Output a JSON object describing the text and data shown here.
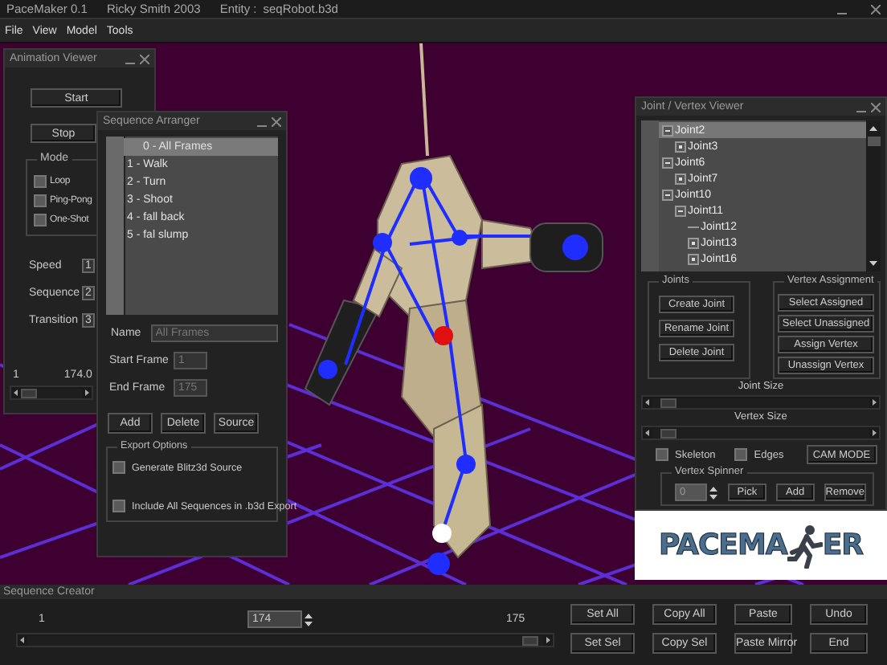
{
  "app": {
    "title": "PaceMaker 0.1",
    "author": "Ricky Smith 2003",
    "entity_label": "Entity  :",
    "entity": "seqRobot.b3d"
  },
  "menu": [
    "File",
    "View",
    "Model",
    "Tools"
  ],
  "animation_viewer": {
    "title": "Animation Viewer",
    "buttons": [
      "Start",
      "Stop"
    ],
    "mode_label": "Mode",
    "modes": [
      {
        "label": "Loop",
        "checked": false
      },
      {
        "label": "Ping-Pong",
        "checked": false
      },
      {
        "label": "One-Shot",
        "checked": false
      }
    ],
    "fields": [
      {
        "label": "Speed",
        "value": "1"
      },
      {
        "label": "Sequence",
        "value": "2"
      },
      {
        "label": "Transition",
        "value": "3"
      }
    ],
    "frame_start": "1",
    "frame_current": "174.0",
    "slider": {
      "level": 0
    }
  },
  "sequence_arranger": {
    "title": "Sequence Arranger",
    "sequences": [
      {
        "label": "0 - All Frames",
        "selected": true
      },
      {
        "label": "1 - Walk",
        "selected": false
      },
      {
        "label": "2 - Turn",
        "selected": false
      },
      {
        "label": "3 - Shoot",
        "selected": false
      },
      {
        "label": "4 - fall back",
        "selected": false
      },
      {
        "label": "5 - fal slump",
        "selected": false
      }
    ],
    "name_label": "Name",
    "name_value": "All Frames",
    "start_label": "Start Frame",
    "start_value": "1",
    "end_label": "End Frame",
    "end_value": "175",
    "buttons": [
      "Add",
      "Delete",
      "Source"
    ],
    "export_title": "Export Options",
    "export_options": [
      {
        "label": "Generate Blitz3d Source",
        "checked": false
      },
      {
        "label": "Include All Sequences in .b3d Export",
        "checked": false
      }
    ]
  },
  "joint_viewer": {
    "title": "Joint / Vertex Viewer",
    "tree": [
      {
        "label": "Joint2",
        "kind": "node",
        "expanded": true,
        "selected": true,
        "children": [
          {
            "label": "Joint3",
            "kind": "node",
            "expanded": false,
            "selected": false
          }
        ]
      },
      {
        "label": "Joint6",
        "kind": "node",
        "expanded": true,
        "selected": false,
        "children": [
          {
            "label": "Joint7",
            "kind": "node",
            "expanded": false,
            "selected": false
          }
        ]
      },
      {
        "label": "Joint10",
        "kind": "node",
        "expanded": true,
        "selected": false,
        "children": [
          {
            "label": "Joint11",
            "kind": "node",
            "expanded": true,
            "selected": false,
            "children": [
              {
                "label": "Joint12",
                "kind": "leaf",
                "expanded": false,
                "selected": false
              },
              {
                "label": "Joint13",
                "kind": "node",
                "expanded": false,
                "selected": false
              },
              {
                "label": "Joint16",
                "kind": "node",
                "expanded": false,
                "selected": false
              }
            ]
          }
        ]
      }
    ],
    "joints_title": "Joints",
    "joint_buttons": [
      "Create Joint",
      "Rename Joint",
      "Delete Joint"
    ],
    "vertex_title": "Vertex Assignment",
    "vertex_buttons": [
      "Select  Assigned",
      "Select  Unassigned",
      "Assign  Vertex",
      "Unassign Vertex"
    ],
    "sliders": [
      {
        "label": "Joint  Size",
        "level": 0.04
      },
      {
        "label": "Vertex Size",
        "level": 0.04
      }
    ],
    "toggles": [
      {
        "label": "Skeleton",
        "checked": false
      },
      {
        "label": "Edges",
        "checked": false
      }
    ],
    "cam_button": "CAM MODE",
    "spinner_title": "Vertex  Spinner",
    "spinner_value": "0",
    "spinner_buttons": [
      "Pick",
      "Add",
      "Remove"
    ]
  },
  "logo": {
    "left": "PACEMA",
    "right": "ER"
  },
  "sequence_creator": {
    "title": "Sequence Creator",
    "start": "1",
    "current": "174",
    "end": "175",
    "slider": {
      "level": 0.99
    },
    "buttons": [
      "Set  All",
      "Copy  All",
      "Paste",
      "Undo",
      "Set  Sel",
      "Copy Sel",
      "Paste Mirror",
      "End"
    ]
  }
}
